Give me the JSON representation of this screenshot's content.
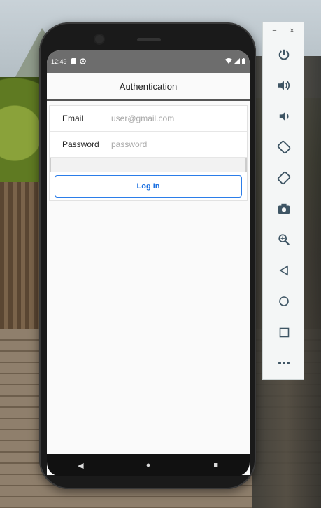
{
  "statusbar": {
    "time": "12:49",
    "left_icons": [
      "sd-card-icon",
      "sync-icon"
    ],
    "right_icons": [
      "wifi-icon",
      "signal-icon",
      "battery-icon"
    ]
  },
  "toolbar": {
    "title": "Authentication"
  },
  "form": {
    "email": {
      "label": "Email",
      "placeholder": "user@gmail.com",
      "value": ""
    },
    "password": {
      "label": "Password",
      "placeholder": "password",
      "value": ""
    },
    "login_label": "Log In"
  },
  "navbar": {
    "back": "◀",
    "home": "●",
    "recents": "■"
  },
  "emulator_panel": {
    "minimize": "−",
    "close": "×",
    "buttons": [
      {
        "name": "power-icon",
        "glyph": "⏻"
      },
      {
        "name": "volume-up-icon",
        "glyph": "🔊"
      },
      {
        "name": "volume-down-icon",
        "glyph": "🔉"
      },
      {
        "name": "rotate-left-icon",
        "glyph": "⟲"
      },
      {
        "name": "rotate-right-icon",
        "glyph": "⟳"
      },
      {
        "name": "camera-icon",
        "glyph": "📷"
      },
      {
        "name": "zoom-icon",
        "glyph": "⊕"
      },
      {
        "name": "back-icon",
        "glyph": "◁"
      },
      {
        "name": "home-icon",
        "glyph": "○"
      },
      {
        "name": "overview-icon",
        "glyph": "□"
      },
      {
        "name": "more-icon",
        "glyph": "•••"
      }
    ]
  }
}
